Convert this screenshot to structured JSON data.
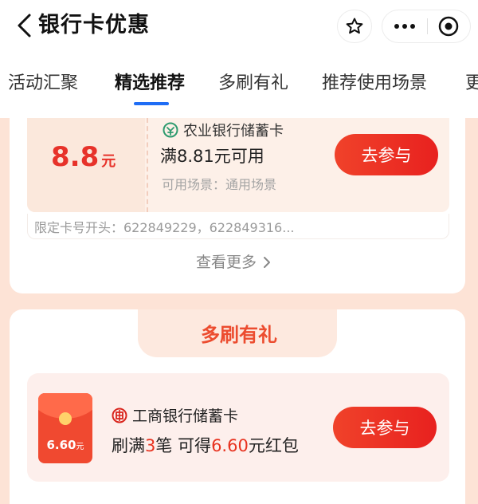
{
  "header": {
    "title": "银行卡优惠"
  },
  "tabs": [
    {
      "label": "活动汇聚",
      "active": false
    },
    {
      "label": "精选推荐",
      "active": true
    },
    {
      "label": "多刷有礼",
      "active": false
    },
    {
      "label": "推荐使用场景",
      "active": false
    },
    {
      "label": "更",
      "active": false
    }
  ],
  "coupon": {
    "amount": "8.8",
    "unit": "元",
    "bank_name": "农业银行储蓄卡",
    "condition": "满8.81元可用",
    "scene": "可用场景：通用场景",
    "button_label": "去参与",
    "card_limit": "限定卡号开头：622849229，622849316...",
    "see_more": "查看更多"
  },
  "multi_swipe": {
    "section_title": "多刷有礼",
    "packet_amount": "6.60",
    "packet_unit": "元",
    "bank_name": "工商银行储蓄卡",
    "cond_prefix": "刷满",
    "cond_count": "3",
    "cond_middle": "笔 可得",
    "cond_amount": "6.60",
    "cond_suffix": "元红包",
    "button_label": "去参与"
  },
  "colors": {
    "accent_red": "#e8321f",
    "tab_underline": "#1f6df5",
    "abc_green": "#2e9b6f",
    "icbc_red": "#d9251d"
  }
}
